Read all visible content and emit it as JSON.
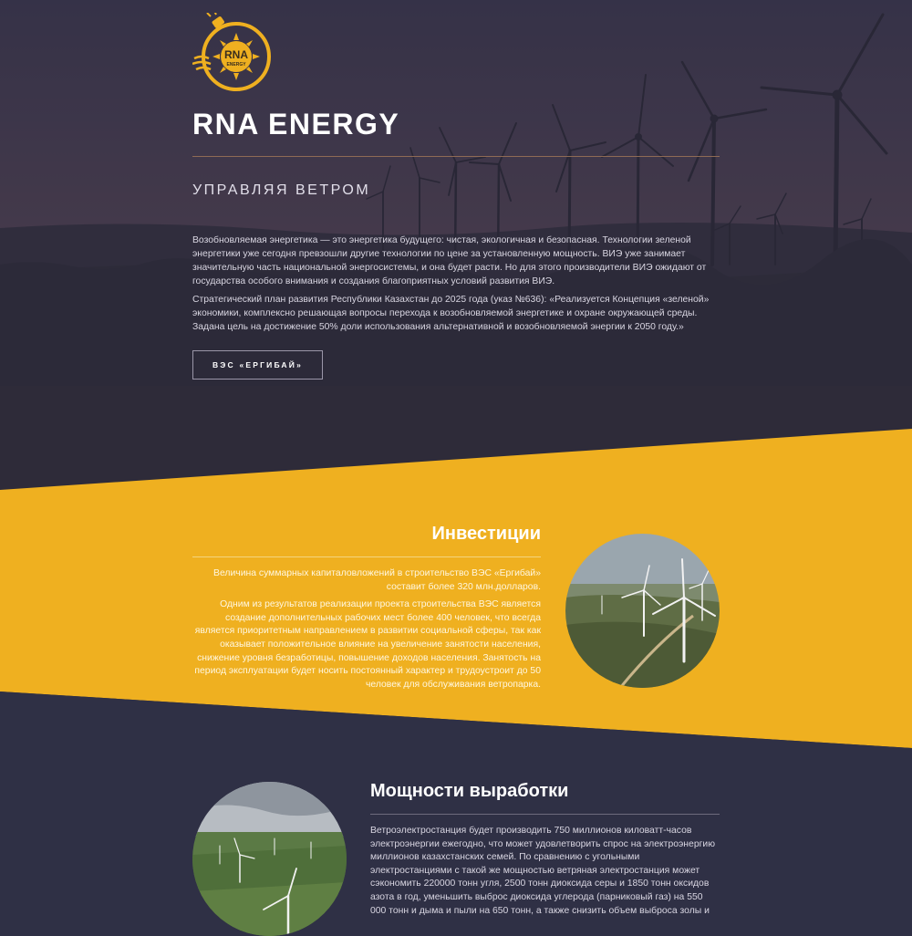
{
  "brand": {
    "title": "RNA ENERGY",
    "logo_text": "RNA",
    "logo_sub": "ENERGY"
  },
  "hero": {
    "tagline": "УПРАВЛЯЯ ВЕТРОМ",
    "paragraphs": [
      "Возобновляемая энергетика — это энергетика будущего: чистая, экологичная и безопасная. Технологии зеленой энергетики уже сегодня превзошли другие технологии по цене за установленную мощность. ВИЭ уже занимает значительную часть национальной энергосистемы, и она будет расти. Но для этого производители ВИЭ ожидают от государства особого внимания и создания благоприятных условий развития ВИЭ.",
      "Стратегический план развития Республики Казахстан до 2025 года (указ №636): «Реализуется Концепция «зеленой» экономики, комплексно решающая вопросы перехода к возобновляемой энергетике и охране окружающей среды. Задана цель на достижение 50% доли использования альтернативной и возобновляемой энергии к 2050 году.»"
    ],
    "button_label": "ВЭС «ЕРГИБАЙ»"
  },
  "investments": {
    "title": "Инвестиции",
    "paragraphs": [
      "Величина суммарных капиталовложений в строительство ВЭС «Ергибай» составит более 320 млн.долларов.",
      "Одним из результатов реализации проекта строительства ВЭС является создание дополнительных рабочих мест более 400 человек, что всегда является приоритетным направлением в развитии социальной сферы, так как оказывает положительное влияние на увеличение занятости населения, снижение уровня безработицы, повышение доходов населения. Занятость на период эксплуатации будет носить постоянный характер и трудоустроит до 50 человек для обслуживания ветропарка."
    ]
  },
  "power": {
    "title": "Мощности выработки",
    "paragraphs": [
      "Ветроэлектростанция будет производить 750 миллионов киловатт-часов электроэнергии ежегодно, что может удовлетворить спрос на электроэнергию миллионов казахстанских семей. По сравнению с угольными электростанциями с такой же мощностью ветряная электростанция может сэкономить 220000 тонн угля, 2500 тонн диоксида серы и 1850 тонн оксидов азота в год, уменьшить выброс диоксида углерода (парниковый газ) на 550 000 тонн и дыма и пыли на 650 тонн, а также снизить объем выброса золы и"
    ]
  },
  "colors": {
    "accent": "#efb020",
    "dark": "#2f3045",
    "hero_top": "#3e3951"
  }
}
